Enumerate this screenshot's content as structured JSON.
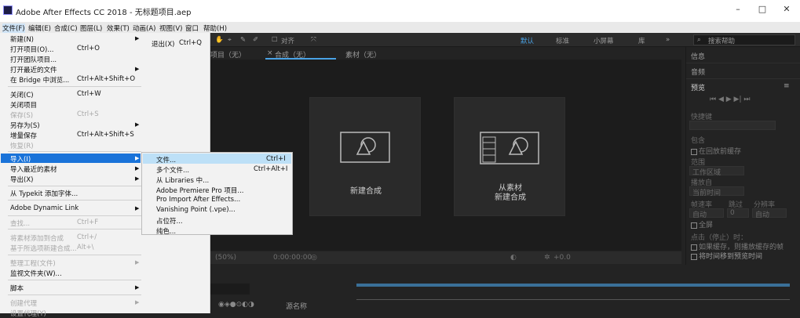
{
  "window": {
    "title": "Adobe After Effects CC 2018 - 无标题项目.aep",
    "minimize": "–",
    "maximize": "□",
    "close": "✕"
  },
  "menubar": [
    "文件(F)",
    "编辑(E)",
    "合成(C)",
    "图层(L)",
    "效果(T)",
    "动画(A)",
    "视图(V)",
    "窗口",
    "帮助(H)"
  ],
  "toolbar": {
    "align": "对齐",
    "workspaces": [
      "默认",
      "标准",
      "小屏幕",
      "库"
    ],
    "search_placeholder": "搜索帮助"
  },
  "panel_tabs": {
    "project": "项目（无）",
    "composition": "合成（无）",
    "footage": "素材（无）"
  },
  "cards": {
    "new_comp": "新建合成",
    "from_footage_line1": "从素材",
    "from_footage_line2": "新建合成"
  },
  "comp_bar": {
    "zoom": "(50%)",
    "timecode": "0:00:00:00",
    "exposure": "+0.0"
  },
  "timeline": {
    "source_name": "源名称"
  },
  "right_panel": {
    "info": "信息",
    "audio": "音频",
    "preview": "预览",
    "shortcut": "快捷键",
    "include": "包含",
    "cache_before": "在回放前缓存",
    "range": "范围",
    "work_area": "工作区域",
    "play_from": "播放自",
    "current_time": "当前时间",
    "frame_rate": "帧速率",
    "skip": "跳过",
    "resolution": "分辨率",
    "auto": "自动",
    "zero": "0",
    "fullscreen": "全屏",
    "on_stop": "点击（停止）时：",
    "if_cached": "如果缓存，则播放缓存的帧",
    "move_time": "将时间移到预览时间"
  },
  "file_menu": {
    "items": [
      {
        "label": "新建(N)",
        "shortcut": "",
        "arrow": true,
        "disabled": false
      },
      {
        "label": "打开项目(O)...",
        "shortcut": "Ctrl+O",
        "arrow": false,
        "disabled": false
      },
      {
        "label": "打开团队项目...",
        "shortcut": "",
        "arrow": false,
        "disabled": false
      },
      {
        "label": "打开最近的文件",
        "shortcut": "",
        "arrow": true,
        "disabled": false
      },
      {
        "label": "在 Bridge 中浏览...",
        "shortcut": "Ctrl+Alt+Shift+O",
        "arrow": false,
        "disabled": false
      },
      {
        "label": "关闭(C)",
        "shortcut": "Ctrl+W",
        "arrow": false,
        "disabled": false
      },
      {
        "label": "关闭项目",
        "shortcut": "",
        "arrow": false,
        "disabled": false
      },
      {
        "label": "保存(S)",
        "shortcut": "Ctrl+S",
        "arrow": false,
        "disabled": true
      },
      {
        "label": "另存为(S)",
        "shortcut": "",
        "arrow": true,
        "disabled": false
      },
      {
        "label": "增量保存",
        "shortcut": "Ctrl+Alt+Shift+S",
        "arrow": false,
        "disabled": false
      },
      {
        "label": "恢复(R)",
        "shortcut": "",
        "arrow": false,
        "disabled": true
      },
      {
        "label": "导入(I)",
        "shortcut": "",
        "arrow": true,
        "disabled": false
      },
      {
        "label": "导入最近的素材",
        "shortcut": "",
        "arrow": true,
        "disabled": false
      },
      {
        "label": "导出(X)",
        "shortcut": "",
        "arrow": true,
        "disabled": false
      },
      {
        "label": "从 Typekit 添加字体...",
        "shortcut": "",
        "arrow": false,
        "disabled": false
      },
      {
        "label": "Adobe Dynamic Link",
        "shortcut": "",
        "arrow": true,
        "disabled": false
      },
      {
        "label": "查找...",
        "shortcut": "Ctrl+F",
        "arrow": false,
        "disabled": true
      },
      {
        "label": "将素材添加到合成",
        "shortcut": "Ctrl+/",
        "arrow": false,
        "disabled": true
      },
      {
        "label": "基于所选项新建合成...",
        "shortcut": "Alt+\\",
        "arrow": false,
        "disabled": true
      },
      {
        "label": "整理工程(文件)",
        "shortcut": "",
        "arrow": true,
        "disabled": true
      },
      {
        "label": "监视文件夹(W)...",
        "shortcut": "",
        "arrow": false,
        "disabled": false
      },
      {
        "label": "脚本",
        "shortcut": "",
        "arrow": true,
        "disabled": false
      },
      {
        "label": "创建代理",
        "shortcut": "",
        "arrow": true,
        "disabled": true
      },
      {
        "label": "设置代理(Y)",
        "shortcut": "",
        "arrow": true,
        "disabled": true
      }
    ],
    "exit": "退出(X)",
    "exit_shortcut": "Ctrl+Q"
  },
  "import_submenu": [
    {
      "label": "文件...",
      "shortcut": "Ctrl+I"
    },
    {
      "label": "多个文件...",
      "shortcut": "Ctrl+Alt+I"
    },
    {
      "label": "从 Libraries 中...",
      "shortcut": ""
    },
    {
      "label": "Adobe Premiere Pro 项目...",
      "shortcut": ""
    },
    {
      "label": "Pro Import After Effects...",
      "shortcut": ""
    },
    {
      "label": "Vanishing Point (.vpe)...",
      "shortcut": ""
    },
    {
      "label": "占位符...",
      "shortcut": ""
    },
    {
      "label": "纯色...",
      "shortcut": ""
    }
  ]
}
